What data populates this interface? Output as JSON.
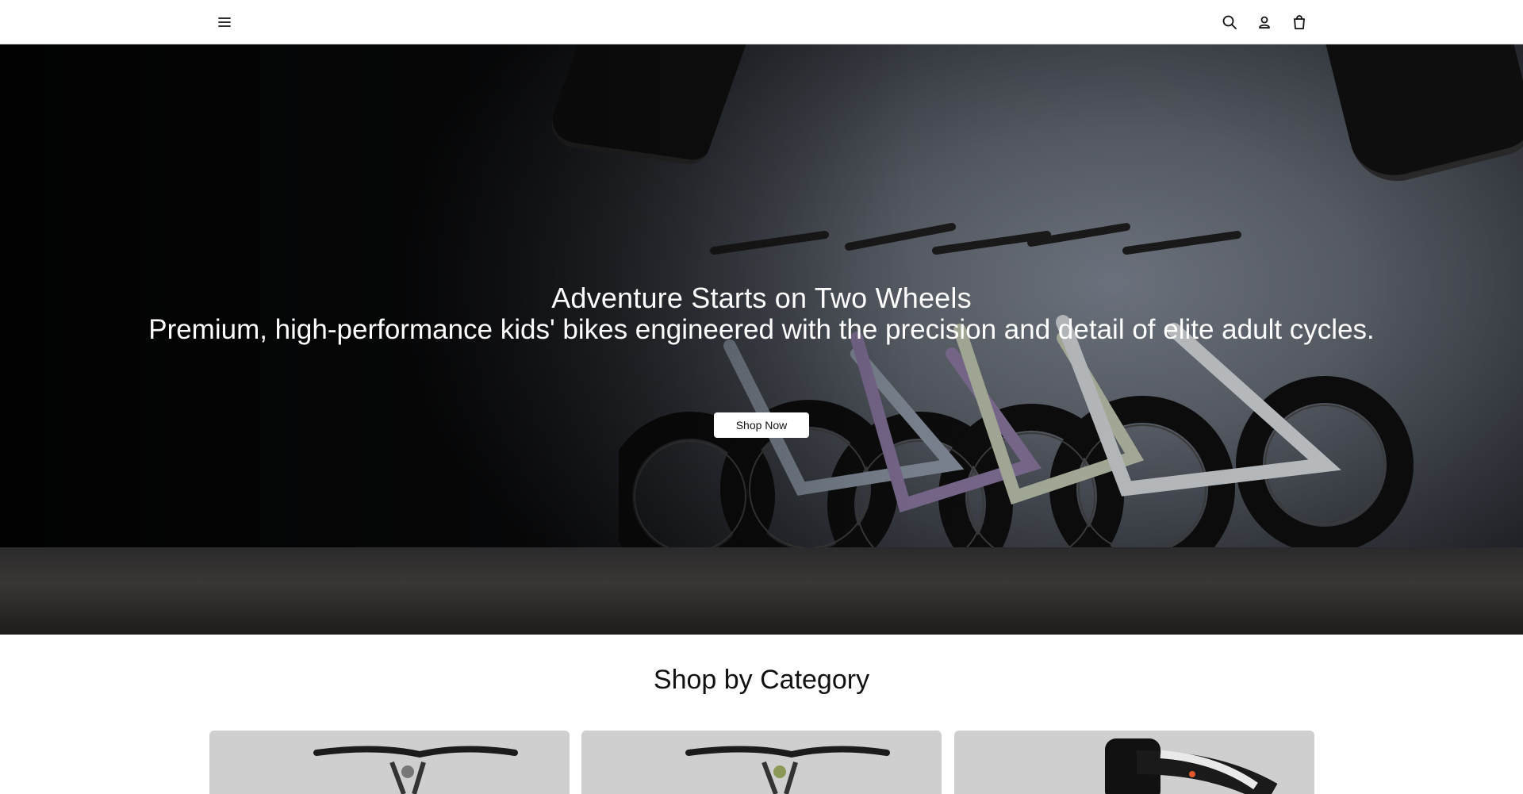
{
  "header": {
    "icons": [
      "menu-icon",
      "search-icon",
      "account-icon",
      "cart-icon"
    ]
  },
  "hero": {
    "title": "Adventure Starts on Two Wheels",
    "subtitle": "Premium, high-performance kids' bikes engineered with the precision and detail of elite adult cycles.",
    "cta_label": "Shop Now"
  },
  "categories": {
    "title": "Shop by Category"
  },
  "colors": {
    "header_bg": "#ffffff",
    "hero_text": "#ffffff",
    "button_bg": "#ffffff",
    "card_bg": "#cfcfcf"
  }
}
